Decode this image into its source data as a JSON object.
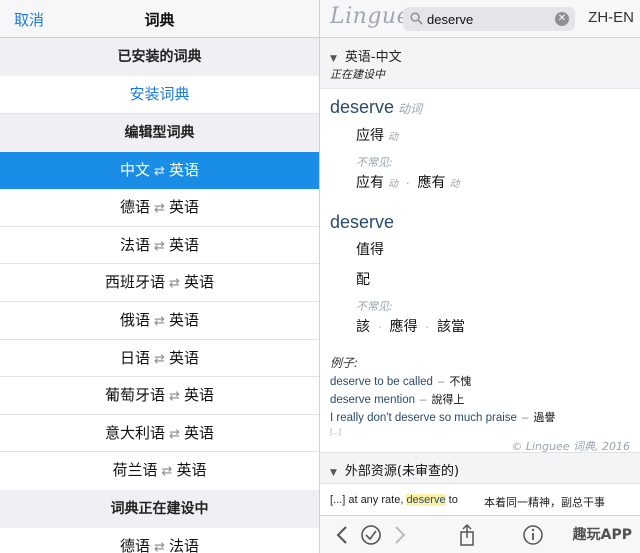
{
  "left": {
    "nav": {
      "cancel": "取消",
      "title": "词典"
    },
    "installed_header": "已安装的词典",
    "install_link": "安装词典",
    "edited_header": "编辑型词典",
    "edited_rows": [
      {
        "a": "中文",
        "b": "英语"
      },
      {
        "a": "德语",
        "b": "英语"
      },
      {
        "a": "法语",
        "b": "英语"
      },
      {
        "a": "西班牙语",
        "b": "英语"
      },
      {
        "a": "俄语",
        "b": "英语"
      },
      {
        "a": "日语",
        "b": "英语"
      },
      {
        "a": "葡萄牙语",
        "b": "英语"
      },
      {
        "a": "意大利语",
        "b": "英语"
      },
      {
        "a": "荷兰语",
        "b": "英语"
      }
    ],
    "arrow": "⇄",
    "building_header": "词典正在建设中",
    "building_rows": [
      {
        "a": "德语",
        "b": "法语"
      }
    ]
  },
  "right": {
    "logo": "Linguee",
    "search": {
      "value": "deserve",
      "placeholder": ""
    },
    "lang": "ZH-EN",
    "dict": {
      "title": "英语-中文",
      "subtitle": "正在建设中"
    },
    "entry1": {
      "headword": "deserve",
      "pos": "动词",
      "main": [
        {
          "text": "应得",
          "pos": "动"
        }
      ],
      "less_common_label": "不常见:",
      "less": [
        {
          "text": "应有",
          "pos": "动"
        },
        {
          "text": "應有",
          "pos": "动"
        }
      ]
    },
    "entry2": {
      "headword": "deserve",
      "main": [
        "值得",
        "配"
      ],
      "less_common_label": "不常见:",
      "less": [
        "該",
        "應得",
        "該當"
      ]
    },
    "examples": {
      "label": "例子:",
      "items": [
        {
          "en": "deserve to be called",
          "cn": "不愧"
        },
        {
          "en": "deserve mention",
          "cn": "說得上"
        },
        {
          "en": "I really don't deserve so much praise",
          "cn": "過譽"
        }
      ],
      "more": "[...]"
    },
    "copyright": "© Linguee 词典, 2016",
    "external": {
      "title": "外部资源(未审查的)"
    },
    "snippet": {
      "en_prefix": "[...] at any rate,",
      "en_highlight": "deserve",
      "en_suffix": "to",
      "cn": "本着同一精神，副总干事"
    },
    "watermark": "趣玩APP"
  }
}
